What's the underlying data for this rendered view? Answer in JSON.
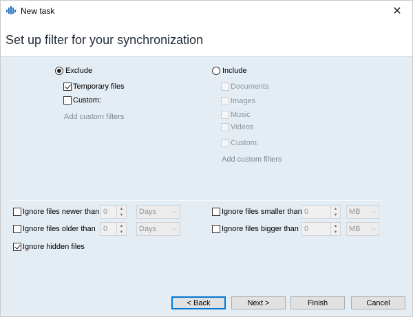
{
  "window": {
    "title": "New task",
    "close_symbol": "✕"
  },
  "header": {
    "title": "Set up filter for your synchronization"
  },
  "exclude": {
    "label": "Exclude",
    "selected": true,
    "options": [
      {
        "label": "Temporary files",
        "checked": true
      },
      {
        "label": "Custom:",
        "checked": false
      }
    ],
    "add_filters": "Add custom filters"
  },
  "include": {
    "label": "Include",
    "selected": false,
    "options": [
      {
        "label": "Documents",
        "checked": false
      },
      {
        "label": "Images",
        "checked": false
      },
      {
        "label": "Music",
        "checked": false
      },
      {
        "label": "Videos",
        "checked": false
      },
      {
        "label": "Custom:",
        "checked": false
      }
    ],
    "add_filters": "Add custom filters"
  },
  "filters": {
    "newer": {
      "label": "Ignore files newer than",
      "checked": false,
      "value": "0",
      "unit": "Days"
    },
    "older": {
      "label": "Ignore files older than",
      "checked": false,
      "value": "0",
      "unit": "Days"
    },
    "hidden": {
      "label": "Ignore hidden files",
      "checked": true
    },
    "smaller": {
      "label": "Ignore files smaller than",
      "checked": false,
      "value": "0",
      "unit": "MB"
    },
    "bigger": {
      "label": "Ignore files bigger than",
      "checked": false,
      "value": "0",
      "unit": "MB"
    }
  },
  "buttons": {
    "back": "< Back",
    "next": "Next >",
    "finish": "Finish",
    "cancel": "Cancel"
  },
  "colors": {
    "panel": "#e4ecf4",
    "header": "#ffffff",
    "accent": "#0078d7"
  }
}
